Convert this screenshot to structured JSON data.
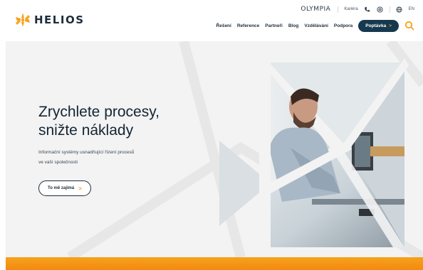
{
  "brand": {
    "name": "HELIOS"
  },
  "topbar": {
    "partner_brand": "OLYMPIA",
    "partner_sub": "",
    "kariera": "Kariéra",
    "language": "EN"
  },
  "nav": {
    "items": [
      "Řešení",
      "Reference",
      "Partneři",
      "Blog",
      "Vzdělávání",
      "Podpora"
    ],
    "cta_label": "Poptávka",
    "cta_arrow": ">"
  },
  "hero": {
    "headline_line1": "Zrychlete procesy,",
    "headline_line2": "snižte náklady",
    "subline_line1": "Informační systémy usnadňující řízení procesů",
    "subline_line2": "ve vaší společnosti",
    "button_label": "To mě zajímá",
    "button_arrow": ">"
  },
  "colors": {
    "accent_orange": "#f6a21a",
    "navy": "#17394f",
    "hero_bg": "#f3f3f3"
  },
  "icons": [
    "helios-logo-icon",
    "phone-icon",
    "mail-icon",
    "globe-icon",
    "search-icon",
    "arrow-right-icon"
  ]
}
